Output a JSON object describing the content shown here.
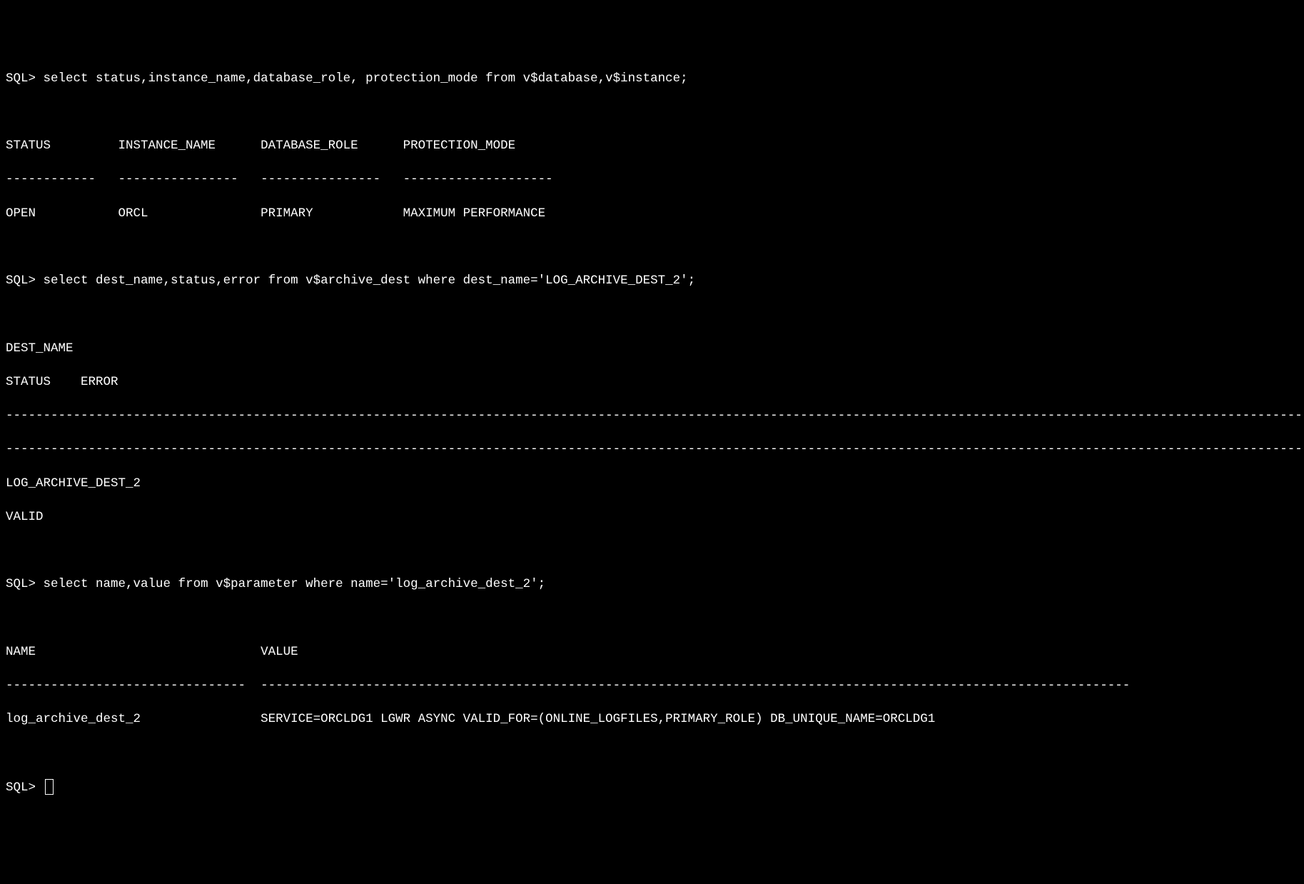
{
  "prompt": "SQL>",
  "q1": {
    "cmd": "select status,instance_name,database_role, protection_mode from v$database,v$instance;",
    "hdr": {
      "c1": "STATUS",
      "c2": "INSTANCE_NAME",
      "c3": "DATABASE_ROLE",
      "c4": "PROTECTION_MODE"
    },
    "sep": {
      "c1": "------------",
      "c2": "----------------",
      "c3": "----------------",
      "c4": "--------------------"
    },
    "row": {
      "c1": "OPEN",
      "c2": "ORCL",
      "c3": "PRIMARY",
      "c4": "MAXIMUM PERFORMANCE"
    }
  },
  "q2": {
    "cmd": "select dest_name,status,error from v$archive_dest where dest_name='LOG_ARCHIVE_DEST_2';",
    "hdr1": "DEST_NAME",
    "hdr2a": "STATUS",
    "hdr2b": "ERROR",
    "row1": "LOG_ARCHIVE_DEST_2",
    "row2": "VALID"
  },
  "q3": {
    "cmd": "select name,value from v$parameter where name='log_archive_dest_2';",
    "hdr": {
      "c1": "NAME",
      "c2": "VALUE"
    },
    "sep": {
      "c1": "--------------------------------",
      "c2": "--------------------------------------------------------------------------------------------------------------------"
    },
    "row": {
      "c1": "log_archive_dest_2",
      "c2": "SERVICE=ORCLDG1 LGWR ASYNC VALID_FOR=(ONLINE_LOGFILES,PRIMARY_ROLE) DB_UNIQUE_NAME=ORCLDG1"
    }
  }
}
